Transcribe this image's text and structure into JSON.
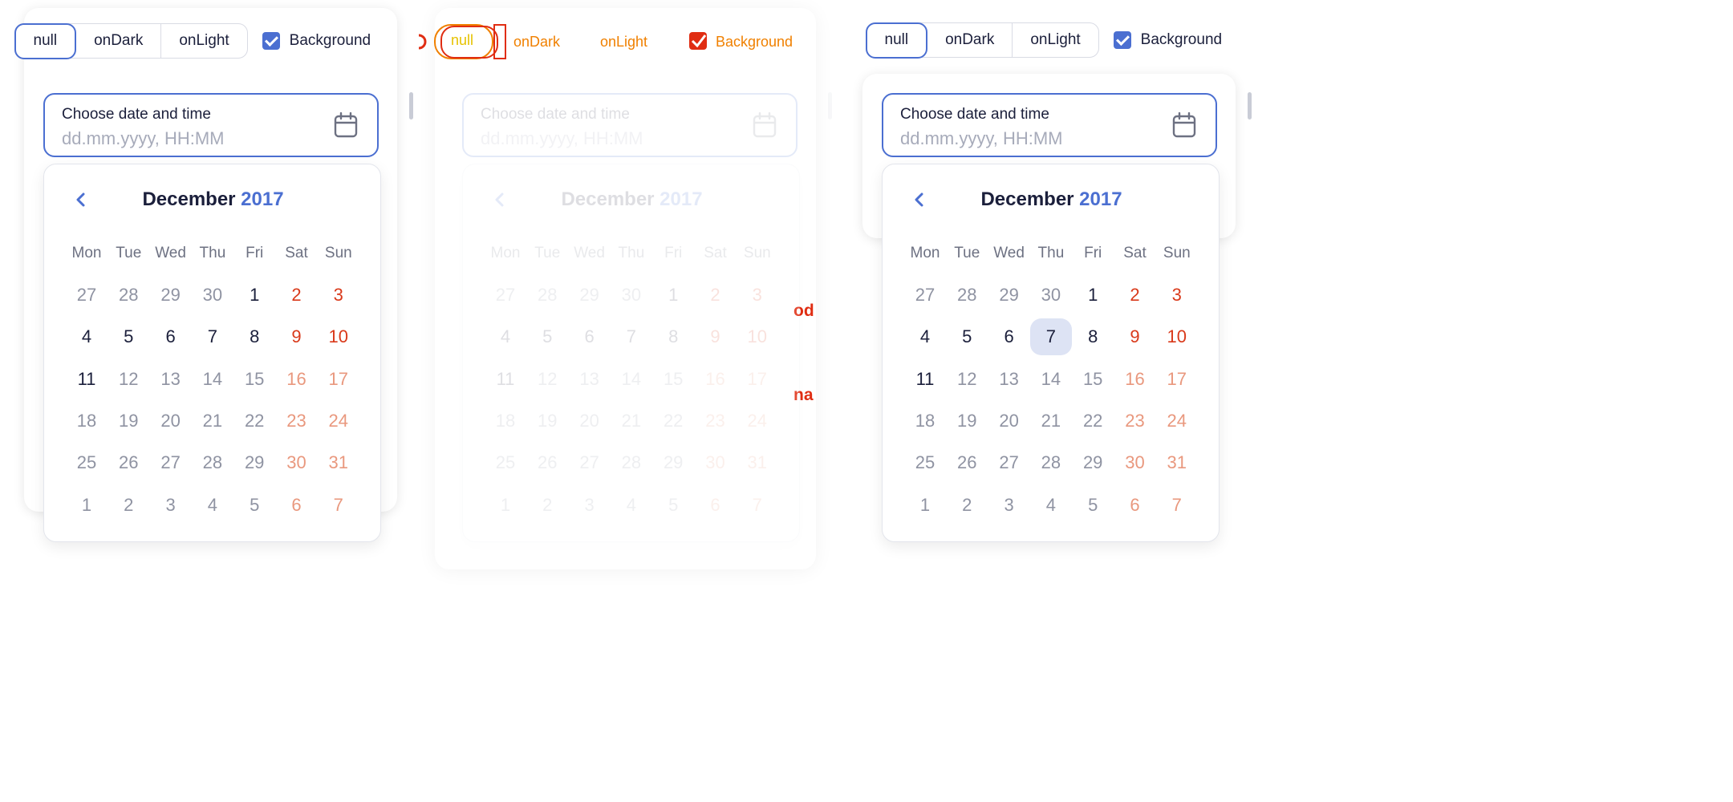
{
  "toolbar": {
    "options": [
      "null",
      "onDark",
      "onLight"
    ],
    "active": "null",
    "background_label": "Background",
    "background_checked": true
  },
  "datepicker": {
    "label": "Choose date and time",
    "placeholder": "dd.mm.yyyy, HH:MM"
  },
  "calendar": {
    "month": "December",
    "year": "2017",
    "weekdays": [
      "Mon",
      "Tue",
      "Wed",
      "Thu",
      "Fri",
      "Sat",
      "Sun"
    ],
    "weeks": [
      [
        "27",
        "28",
        "29",
        "30",
        "1",
        "2",
        "3"
      ],
      [
        "4",
        "5",
        "6",
        "7",
        "8",
        "9",
        "10"
      ],
      [
        "11",
        "12",
        "13",
        "14",
        "15",
        "16",
        "17"
      ],
      [
        "18",
        "19",
        "20",
        "21",
        "22",
        "23",
        "24"
      ],
      [
        "25",
        "26",
        "27",
        "28",
        "29",
        "30",
        "31"
      ],
      [
        "1",
        "2",
        "3",
        "4",
        "5",
        "6",
        "7"
      ]
    ],
    "selected_day_right_panel": "7"
  },
  "behind_text": {
    "line1": "od",
    "line2": "na"
  },
  "colors": {
    "accent": "#4b6fd1",
    "weekend": "#d9391a",
    "behind_green": "#3aa57e",
    "behind_red": "#e02d12",
    "overlay_orange": "#f08000"
  }
}
